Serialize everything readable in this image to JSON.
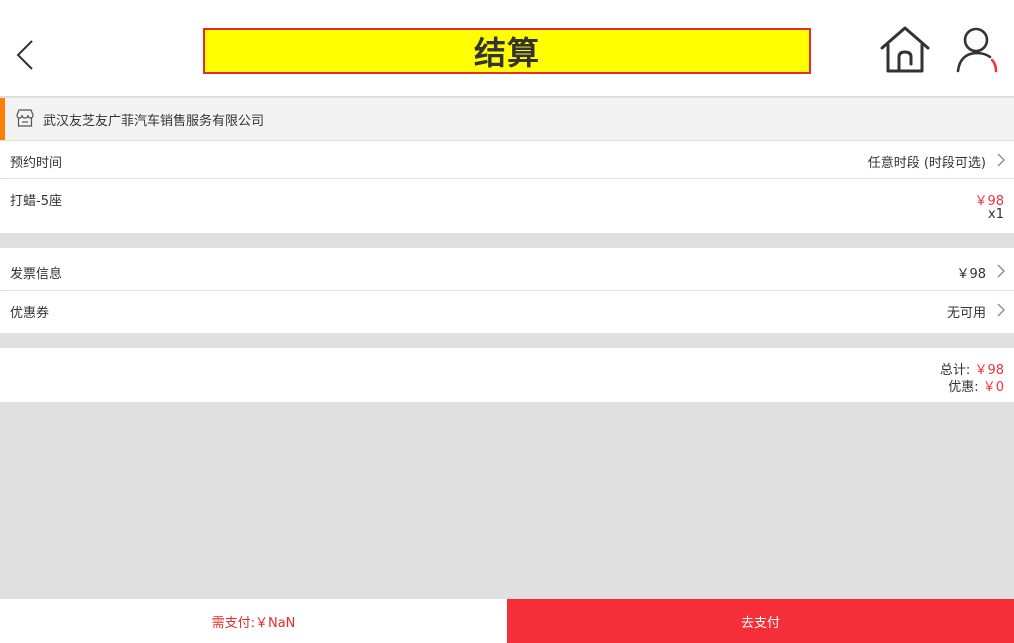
{
  "header": {
    "title": "结算",
    "icons": {
      "back": "chevron-left-icon",
      "home": "home-icon",
      "user": "user-icon"
    }
  },
  "shop": {
    "name": "武汉友芝友广菲汽车销售服务有限公司",
    "icon": "store-icon"
  },
  "appointment": {
    "label": "预约时间",
    "value": "任意时段 (时段可选)"
  },
  "service": {
    "name": "打蜡-5座",
    "price": "￥98",
    "quantity": "x1"
  },
  "invoice": {
    "label": "发票信息",
    "value": "￥98"
  },
  "coupon": {
    "label": "优惠券",
    "value": "无可用"
  },
  "summary": {
    "total_label": "总计:",
    "total_value": "￥98",
    "discount_label": "优惠:",
    "discount_value": "￥0"
  },
  "footer": {
    "pay_amount": "需支付:￥NaN",
    "pay_button": "去支付"
  },
  "colors": {
    "accent_red": "#f52f3a",
    "price_red": "#f0343f",
    "title_bg": "#ffff00",
    "shop_accent": "#ff7f00"
  }
}
